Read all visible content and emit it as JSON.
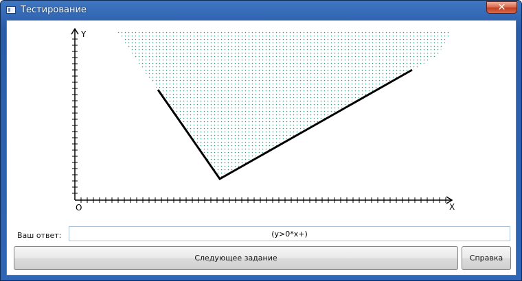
{
  "window": {
    "title": "Тестирование",
    "close_symbol": "✕"
  },
  "graph": {
    "y_axis_label": "Y",
    "x_axis_label": "X",
    "origin_label": "O"
  },
  "answer": {
    "label": "Ваш ответ:",
    "value": "(y>0*x+)"
  },
  "buttons": {
    "next": "Следующее задание",
    "help": "Справка"
  }
}
